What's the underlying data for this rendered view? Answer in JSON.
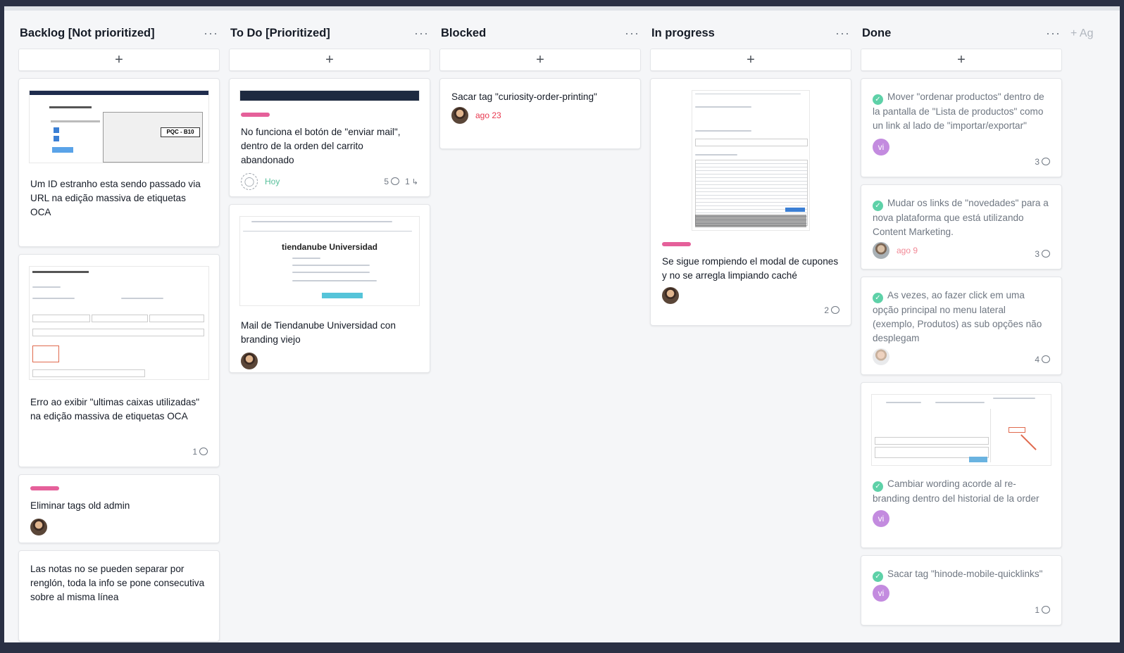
{
  "columns": [
    {
      "title": "Backlog [Not prioritized]",
      "menu": "···",
      "add": "+",
      "cards": [
        {
          "title": "Um ID estranho esta sendo passado via URL na edição massiva de etiquetas OCA"
        },
        {
          "title": "Erro ao exibir \"ultimas caixas utilizadas\" na edição massiva de etiquetas OCA",
          "comments": "1"
        },
        {
          "title": "Eliminar tags old admin"
        },
        {
          "title": "Las notas no se pueden separar por renglón, toda la info se pone consecutiva sobre al misma línea"
        }
      ]
    },
    {
      "title": "To Do [Prioritized]",
      "menu": "···",
      "add": "+",
      "cards": [
        {
          "title": "No funciona el botón de \"enviar mail\", dentro de la orden del carrito abandonado",
          "due": "Hoy",
          "comments": "5",
          "subtasks": "1"
        },
        {
          "title": "Mail de Tiendanube Universidad con branding viejo",
          "thumb_text": "tiendanube Universidad"
        }
      ]
    },
    {
      "title": "Blocked",
      "menu": "···",
      "add": "+",
      "cards": [
        {
          "title": "Sacar tag \"curiosity-order-printing\"",
          "due": "ago 23"
        }
      ]
    },
    {
      "title": "In progress",
      "menu": "···",
      "add": "+",
      "cards": [
        {
          "title": "Se sigue rompiendo el modal de cupones y no se arregla limpiando caché",
          "comments": "2"
        }
      ]
    },
    {
      "title": "Done",
      "menu": "···",
      "add": "+",
      "cards": [
        {
          "title": "Mover \"ordenar productos\" dentro de la pantalla de \"Lista de productos\" como un link al lado de \"importar/exportar\"",
          "avatar": "vi",
          "comments": "3"
        },
        {
          "title": "Mudar os links de \"novedades\" para a nova plataforma que está utilizando Content Marketing.",
          "due": "ago 9",
          "comments": "3"
        },
        {
          "title": "As vezes, ao fazer click em uma opção principal no menu lateral (exemplo, Produtos) as sub opções não desplegam",
          "comments": "4"
        },
        {
          "title": "Cambiar wording acorde al re-branding dentro del historial de la order",
          "avatar": "vi"
        },
        {
          "title": "Sacar tag \"hinode-mobile-quicklinks\"",
          "avatar": "vi",
          "comments": "1"
        }
      ]
    }
  ],
  "add_column": "+ Ag",
  "colors": {
    "tag": "#e5609a",
    "check": "#5ed1a8",
    "due_red": "#e8384f",
    "due_green": "#58c09b",
    "avatar_vi": "#c38bdf"
  }
}
